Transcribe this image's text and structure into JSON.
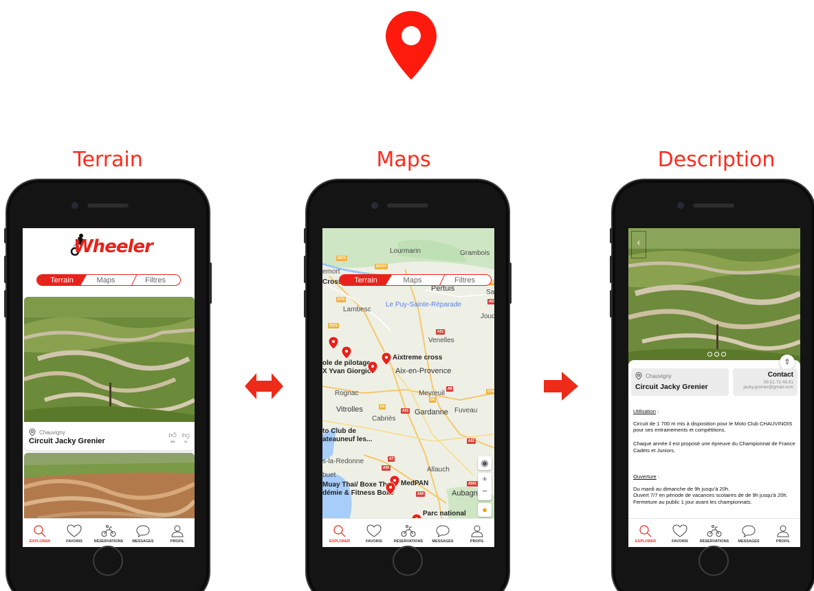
{
  "colors": {
    "accent": "#e8221a",
    "title": "#ff2a1d",
    "phone": "#141414"
  },
  "titles": {
    "terrain": "Terrain",
    "maps": "Maps",
    "description": "Description"
  },
  "segmented": {
    "terrain": "Terrain",
    "maps": "Maps",
    "filters": "Filtres"
  },
  "brand": {
    "name": "Wheeler"
  },
  "tabbar": {
    "items": [
      {
        "label": "EXPLORER",
        "icon": "search-icon"
      },
      {
        "label": "FAVORIS",
        "icon": "heart-icon"
      },
      {
        "label": "RÉSERVATIONS",
        "icon": "motorbike-icon"
      },
      {
        "label": "MESSAGES",
        "icon": "chat-bubble-icon"
      },
      {
        "label": "PROFIL",
        "icon": "user-icon"
      }
    ]
  },
  "terrain_screen": {
    "card": {
      "location": "Chauvigny",
      "name": "Circuit Jacky Grenier",
      "likes": "345",
      "dislikes": "51"
    }
  },
  "map_screen": {
    "places": {
      "lourmarin": "Lourmarin",
      "grambois": "Grambois",
      "pertuis": "Pertuis",
      "saint": "Saint",
      "lambesc": "Lambesc",
      "puy": "Le Puy-Sainte-Réparade",
      "jouques": "Jouque",
      "venelles": "Venelles",
      "aixtreme": "Aixtreme cross",
      "aix": "Aix-en-Provence",
      "ecole1": "ole de pilotage",
      "ecole2": "X Yvan Giorgio",
      "cross": "Cross",
      "emort": "emort",
      "rognac": "Rognac",
      "meyreuil": "Meyreuil",
      "vitrolles": "Vitrolles",
      "cabries": "Cabriès",
      "gardanne": "Gardanne",
      "fuveau": "Fuveau",
      "club1": "to Club de",
      "club2": "ateauneuf les...",
      "redonne": "s-la-Redonne",
      "allauch": "Allauch",
      "medpan": "MedPAN",
      "aubagne": "Aubagne",
      "muay1": "Muay Thai/ Boxe Thai",
      "muay2": "démie & Fitness Boxe",
      "parc": "Parc national",
      "buet": "buet"
    },
    "roads": [
      "D973",
      "D973Y",
      "D7N",
      "D572",
      "A51",
      "A51",
      "D973",
      "A8",
      "D6",
      "D7N",
      "A51",
      "D9",
      "A52",
      "A7",
      "A55",
      "A501",
      "A50"
    ]
  },
  "description_screen": {
    "location": "Chauvigny",
    "name": "Circuit Jacky Grenier",
    "contact_title": "Contact",
    "phone": "09.51.72.48.91",
    "email": "jacky.grenier@gmail.com",
    "usage_heading": "Utilisation",
    "usage_p1": "Circuit de 1 700 m mis à disposition pour le Moto Club CHAUVINOIS pour ses entrainements et compétitions.",
    "usage_p2": "Chaque année il est proposé une épreuve du Championnat de France Cadets et Juniors.",
    "opening_heading": "Ouverture",
    "opening_l1": "Du mardi au dimanche de 9h jusqu'à 20h.",
    "opening_l2": "Ouvert 7/7 en période de vacances scolaires de de 9h jusqu'à 20h.",
    "opening_l3": "Fermeture au public 1 jour avant les championnats.",
    "colon": " :"
  }
}
